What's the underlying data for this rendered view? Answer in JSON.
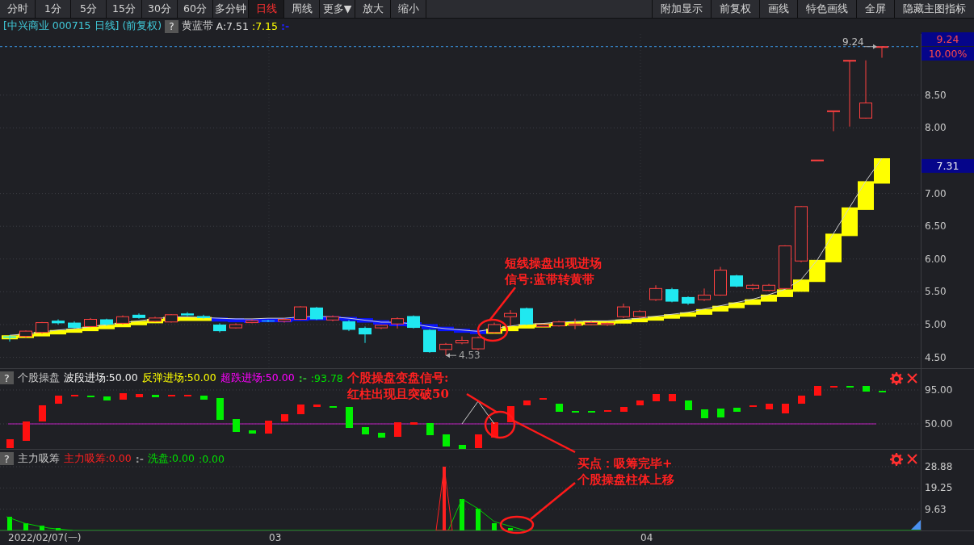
{
  "toolbar": {
    "left": [
      {
        "label": "分时",
        "selected": false
      },
      {
        "label": "1分",
        "selected": false
      },
      {
        "label": "5分",
        "selected": false
      },
      {
        "label": "15分",
        "selected": false
      },
      {
        "label": "30分",
        "selected": false
      },
      {
        "label": "60分",
        "selected": false
      },
      {
        "label": "多分钟",
        "selected": false
      },
      {
        "label": "日线",
        "selected": true
      },
      {
        "label": "周线",
        "selected": false
      },
      {
        "label": "更多▼",
        "selected": false
      },
      {
        "label": "放大",
        "selected": false
      },
      {
        "label": "缩小",
        "selected": false
      }
    ],
    "right": [
      "附加显示",
      "前复权",
      "画线",
      "特色画线",
      "全屏",
      "隐藏主图指标"
    ]
  },
  "title": {
    "stock": "[中兴商业 000715 日线]",
    "adjust": "(前复权)",
    "help": "?",
    "indicator": "黄蓝带",
    "values": [
      {
        "text": "A:7.51",
        "color": "#d8d8d8"
      },
      {
        "text": ":7.15",
        "color": "#ffff00"
      },
      {
        "text": ":-",
        "color": "#2020ff"
      }
    ]
  },
  "main_chart": {
    "price_ticks": [
      "8.50",
      "8.00",
      "7.00",
      "6.50",
      "6.00",
      "5.50",
      "5.00",
      "4.50"
    ],
    "high_label": "9.24",
    "low_label": "4.53",
    "last_price": "9.24",
    "change": "10.00%",
    "band_value": "7.31",
    "annotation": [
      "短线操盘出现进场",
      "信号:蓝带转黄带"
    ]
  },
  "panels": [
    {
      "help": "?",
      "name": "个股操盘",
      "values": [
        {
          "text": "波段进场:50.00",
          "color": "#f0f0f0"
        },
        {
          "text": "反弹进场:50.00",
          "color": "#ffff00"
        },
        {
          "text": "超跌进场:50.00",
          "color": "#ff00ff"
        },
        {
          "text": ":-",
          "color": "#30b030"
        },
        {
          "text": ":93.78",
          "color": "#00e000"
        }
      ],
      "ticks": [
        "95.00",
        "50.00"
      ],
      "annotation": [
        "个股操盘变盘信号:",
        "红柱出现且突破50"
      ]
    },
    {
      "help": "?",
      "name": "主力吸筹",
      "values": [
        {
          "text": "主力吸筹:0.00",
          "color": "#ff2020"
        },
        {
          "text": ":-",
          "color": "#909090"
        },
        {
          "text": "洗盘:0.00",
          "color": "#00e000"
        },
        {
          "text": ":0.00",
          "color": "#00e000"
        }
      ],
      "ticks": [
        "28.88",
        "19.25",
        "9.63"
      ],
      "annotation": [
        "买点：吸筹完毕+",
        "个股操盘柱体上移"
      ]
    }
  ],
  "date_axis": [
    "2022/02/07(一)",
    "03",
    "04"
  ]
}
